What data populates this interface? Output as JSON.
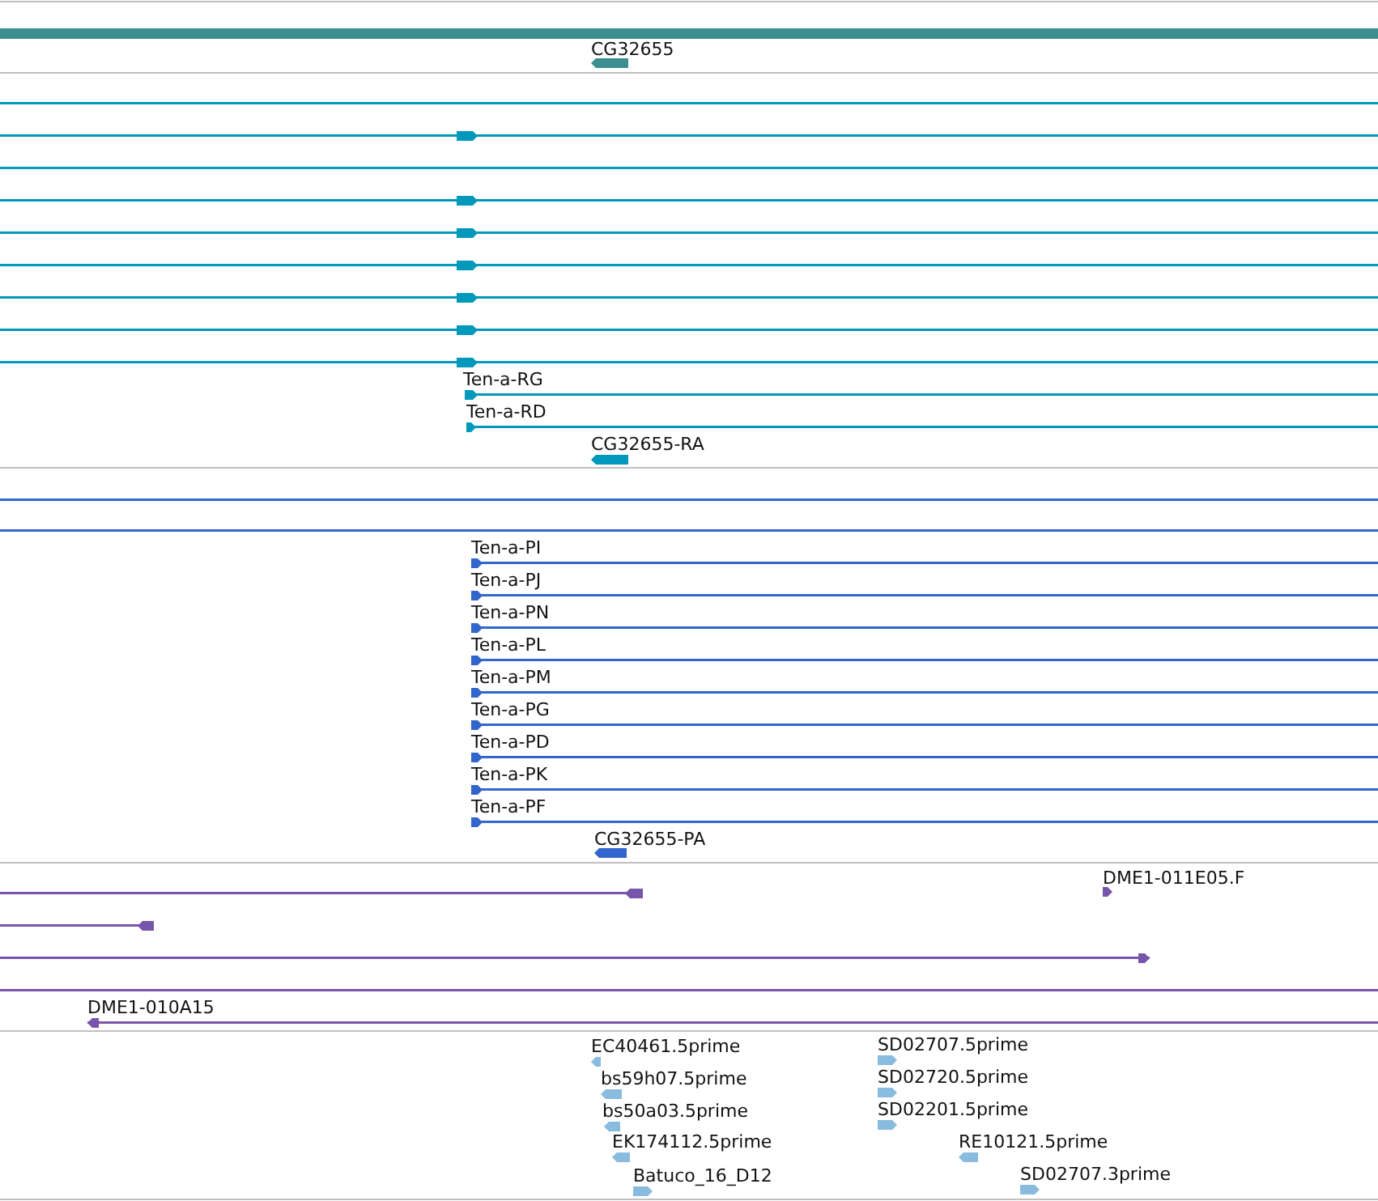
{
  "tracks": [
    {
      "color": "#3d8f8f",
      "features": [
        {
          "kind": "line"
        },
        {
          "label": "CG32655",
          "kind": "reverse"
        }
      ]
    },
    {
      "color": "#0099bb",
      "features": [
        {
          "kind": "line"
        },
        {
          "kind": "forward"
        },
        {
          "kind": "line"
        },
        {
          "kind": "forward"
        },
        {
          "kind": "forward"
        },
        {
          "kind": "forward"
        },
        {
          "kind": "forward"
        },
        {
          "kind": "forward"
        },
        {
          "kind": "forward"
        },
        {
          "label": "Ten-a-RG",
          "kind": "forward"
        },
        {
          "label": "Ten-a-RD",
          "kind": "forward"
        },
        {
          "label": "CG32655-RA",
          "kind": "reverse"
        }
      ]
    },
    {
      "color": "#3366cc",
      "features": [
        {
          "kind": "line"
        },
        {
          "kind": "line"
        },
        {
          "label": "Ten-a-PI",
          "kind": "forward"
        },
        {
          "label": "Ten-a-PJ",
          "kind": "forward"
        },
        {
          "label": "Ten-a-PN",
          "kind": "forward"
        },
        {
          "label": "Ten-a-PL",
          "kind": "forward"
        },
        {
          "label": "Ten-a-PM",
          "kind": "forward"
        },
        {
          "label": "Ten-a-PG",
          "kind": "forward"
        },
        {
          "label": "Ten-a-PD",
          "kind": "forward"
        },
        {
          "label": "Ten-a-PK",
          "kind": "forward"
        },
        {
          "label": "Ten-a-PF",
          "kind": "forward"
        },
        {
          "label": "CG32655-PA",
          "kind": "reverse"
        }
      ]
    },
    {
      "color": "#7755aa",
      "features": [
        {
          "kind": "reverse"
        },
        {
          "label": "DME1-011E05.F",
          "kind": "forward"
        },
        {
          "kind": "reverse"
        },
        {
          "kind": "forward"
        },
        {
          "kind": "line"
        },
        {
          "label": "DME1-010A15",
          "kind": "reverse"
        }
      ]
    },
    {
      "color": "#88bbdd",
      "features": [
        {
          "label": "EC40461.5prime",
          "kind": "reverse"
        },
        {
          "label": "bs59h07.5prime",
          "kind": "reverse"
        },
        {
          "label": "bs50a03.5prime",
          "kind": "reverse"
        },
        {
          "label": "EK174112.5prime",
          "kind": "reverse"
        },
        {
          "label": "Batuco_16_D12",
          "kind": "forward"
        },
        {
          "label": "SD02707.5prime",
          "kind": "forward"
        },
        {
          "label": "SD02720.5prime",
          "kind": "forward"
        },
        {
          "label": "SD02201.5prime",
          "kind": "forward"
        },
        {
          "label": "RE10121.5prime",
          "kind": "reverse"
        },
        {
          "label": "SD02707.3prime",
          "kind": "forward"
        }
      ]
    }
  ]
}
